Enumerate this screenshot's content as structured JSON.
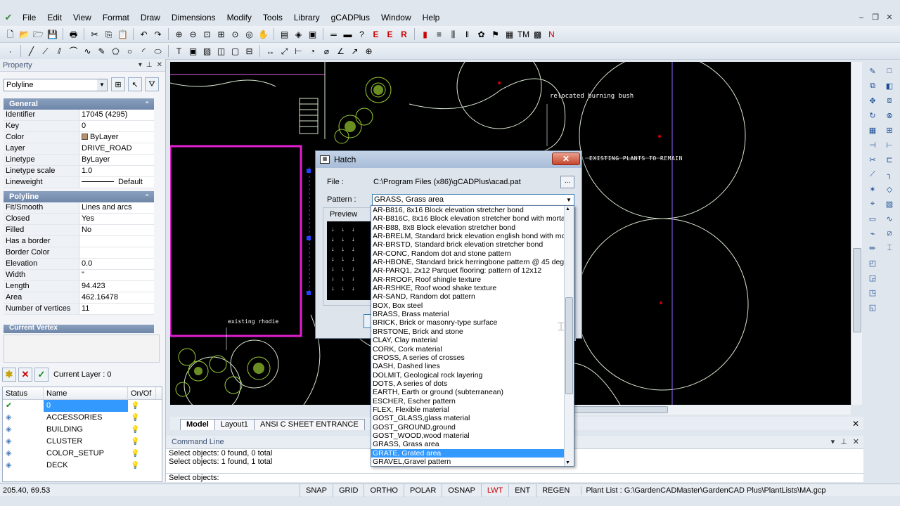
{
  "menu": [
    "File",
    "Edit",
    "View",
    "Format",
    "Draw",
    "Dimensions",
    "Modify",
    "Tools",
    "Library",
    "gCADPlus",
    "Window",
    "Help"
  ],
  "window_controls": [
    "–",
    "❐",
    "✕"
  ],
  "property_panel": {
    "title": "Property",
    "object_type": "Polyline",
    "sections": {
      "general": "General",
      "polyline": "Polyline",
      "current_vertex": "Current Vertex"
    },
    "general_rows": [
      {
        "key": "Identifier",
        "value": "17045 (4295)"
      },
      {
        "key": "Key",
        "value": "0"
      },
      {
        "key": "Color",
        "value": "ByLayer"
      },
      {
        "key": "Layer",
        "value": "DRIVE_ROAD"
      },
      {
        "key": "Linetype",
        "value": "ByLayer"
      },
      {
        "key": "Linetype scale",
        "value": "1.0"
      },
      {
        "key": "Lineweight",
        "value": "Default"
      }
    ],
    "polyline_rows": [
      {
        "key": "Fit/Smooth",
        "value": "Lines and arcs"
      },
      {
        "key": "Closed",
        "value": "Yes"
      },
      {
        "key": "Filled",
        "value": "No"
      },
      {
        "key": "Has a border",
        "value": ""
      },
      {
        "key": "Border Color",
        "value": ""
      },
      {
        "key": "Elevation",
        "value": "0.0"
      },
      {
        "key": "Width",
        "value": "\""
      },
      {
        "key": "Length",
        "value": "94.423"
      },
      {
        "key": "Area",
        "value": "462.16478"
      },
      {
        "key": "Number of vertices",
        "value": "11"
      }
    ]
  },
  "layers": {
    "current_layer": "Current Layer : 0",
    "columns": [
      "Status",
      "Name",
      "On/Of"
    ],
    "rows": [
      "0",
      "ACCESSORIES",
      "BUILDING",
      "CLUSTER",
      "COLOR_SETUP",
      "DECK"
    ]
  },
  "drawing": {
    "labels": {
      "relocated": "relocated burning bush",
      "existing_plants": "EXISTING PLANTS TO REMAIN",
      "existing_rhodie": "existing rhodie"
    },
    "tabs": [
      "Model",
      "Layout1",
      "ANSI C SHEET ENTRANCE"
    ]
  },
  "hatch_dialog": {
    "title": "Hatch",
    "file_label": "File :",
    "file_value": "C:\\Program Files (x86)\\gCADPlus\\acad.pat",
    "pattern_label": "Pattern :",
    "pattern_value": "GRASS, Grass area",
    "preview_label": "Preview",
    "browse_label": "...",
    "patterns": [
      "AR-B816, 8x16 Block elevation stretcher bond",
      "AR-B816C, 8x16 Block elevation stretcher bond with mortar j",
      "AR-B88, 8x8 Block elevation stretcher bond",
      "AR-BRELM, Standard brick elevation english bond with mort",
      "AR-BRSTD, Standard brick elevation stretcher bond",
      "AR-CONC, Random dot and stone pattern",
      "AR-HBONE, Standard brick herringbone pattern @ 45 degre",
      "AR-PARQ1, 2x12 Parquet flooring: pattern of 12x12",
      "AR-RROOF, Roof shingle texture",
      "AR-RSHKE, Roof wood shake texture",
      "AR-SAND, Random dot pattern",
      "BOX, Box steel",
      "BRASS, Brass material",
      "BRICK, Brick or masonry-type surface",
      "BRSTONE, Brick and stone",
      "CLAY, Clay material",
      "CORK, Cork material",
      "CROSS, A series of crosses",
      "DASH, Dashed lines",
      "DOLMIT, Geological rock layering",
      "DOTS, A series of dots",
      "EARTH, Earth or ground (subterranean)",
      "ESCHER, Escher pattern",
      "FLEX, Flexible material",
      "GOST_GLASS,glass material",
      "GOST_GROUND,ground",
      "GOST_WOOD,wood material",
      "GRASS, Grass area",
      "GRATE, Grated area",
      "GRAVEL,Gravel pattern"
    ],
    "selected_index": 28
  },
  "command_line": {
    "title": "Command Line",
    "lines": [
      "Select objects:  0 found,  0 total",
      "Select objects:  1 found,  1 total"
    ],
    "prompt": "Select objects:"
  },
  "status_bar": {
    "coords": "205.40,  69.53",
    "toggles": [
      "SNAP",
      "GRID",
      "ORTHO",
      "POLAR",
      "OSNAP",
      "LWT",
      "ENT",
      "REGEN"
    ],
    "active_toggle": "LWT",
    "plant_list": "Plant List : G:\\GardenCADMaster\\GardenCAD Plus\\PlantLists\\MA.gcp"
  },
  "colors": {
    "magenta": "#e020d0",
    "drawing_line": "#d8e8d0",
    "plant_green": "#9acd32",
    "selection": "#3399ff"
  }
}
